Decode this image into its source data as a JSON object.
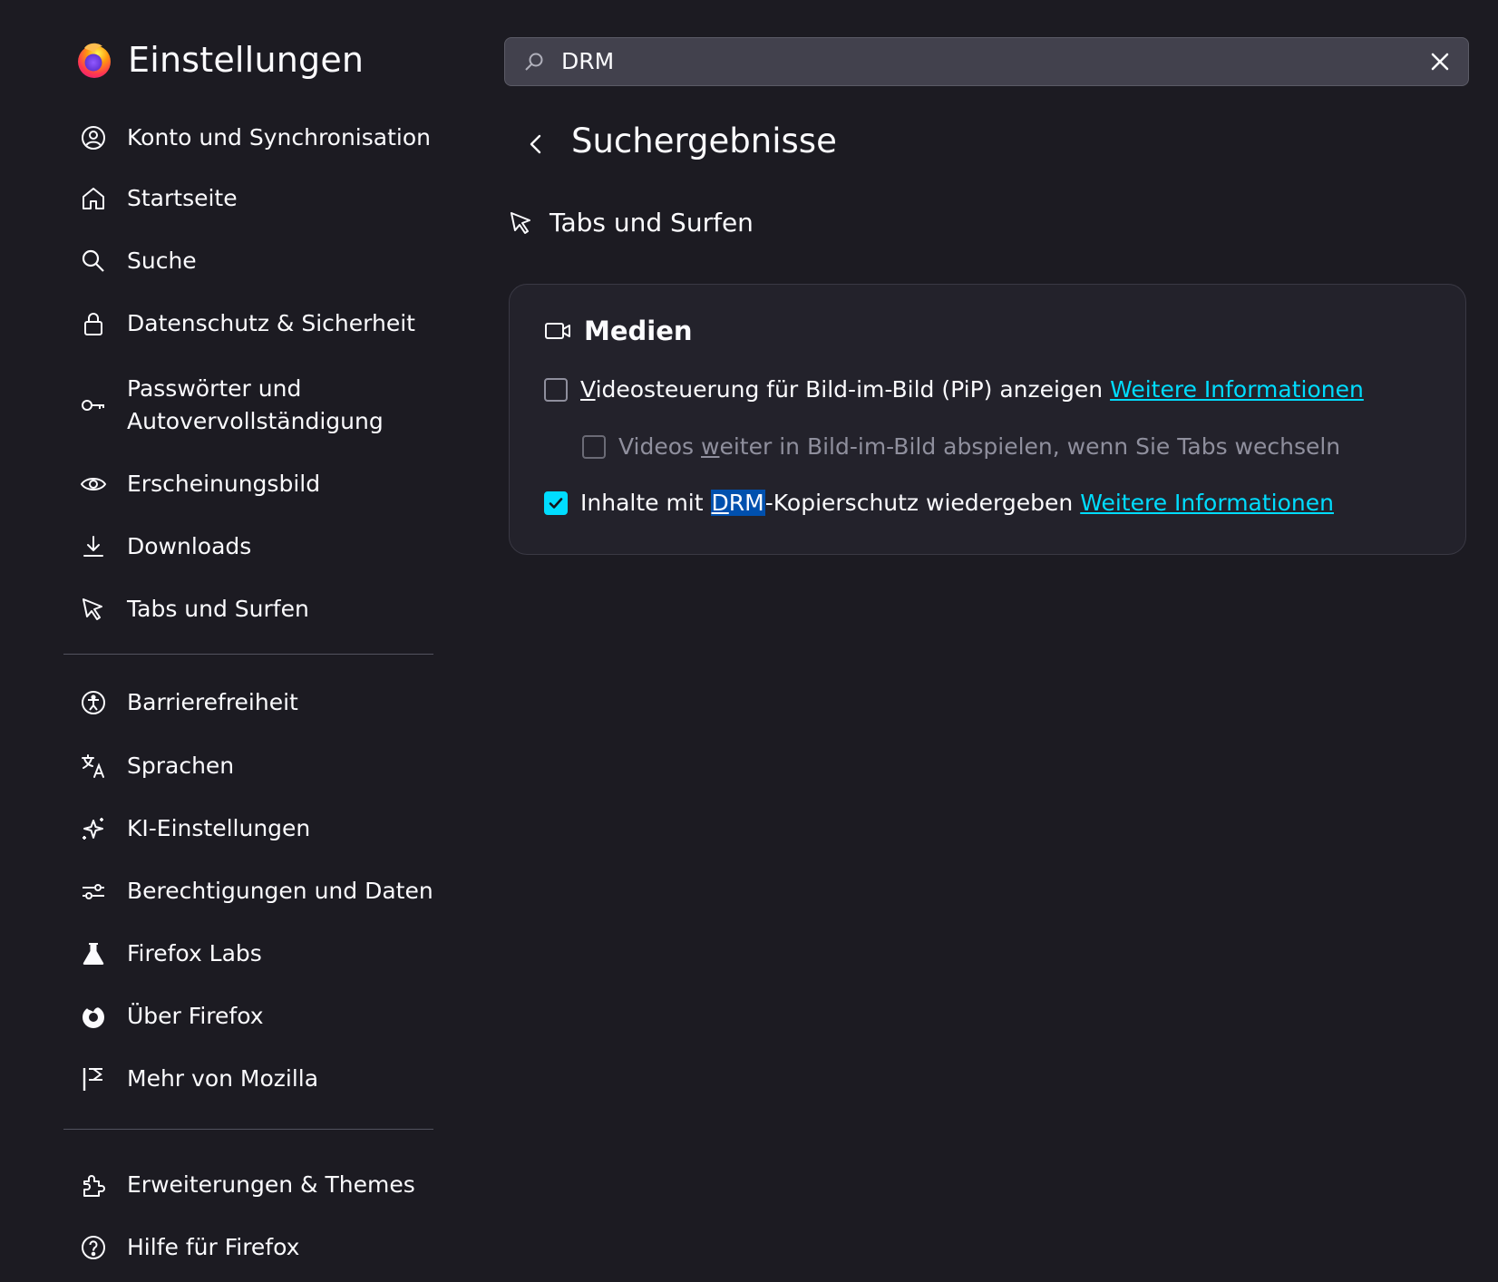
{
  "app": {
    "title": "Einstellungen",
    "logo": "firefox-logo-icon"
  },
  "sidebar": {
    "items": [
      {
        "label": "Konto und Synchronisation",
        "icon": "account-circle-icon"
      },
      {
        "label": "Startseite",
        "icon": "home-icon"
      },
      {
        "label": "Suche",
        "icon": "search-icon"
      },
      {
        "label": "Datenschutz & Sicherheit",
        "icon": "lock-icon"
      },
      {
        "label": "Passwörter und Autovervollständigung",
        "icon": "key-icon"
      },
      {
        "label": "Erscheinungsbild",
        "icon": "eye-icon"
      },
      {
        "label": "Downloads",
        "icon": "download-icon"
      },
      {
        "label": "Tabs und Surfen",
        "icon": "cursor-icon"
      }
    ],
    "items2": [
      {
        "label": "Barrierefreiheit",
        "icon": "accessibility-icon"
      },
      {
        "label": "Sprachen",
        "icon": "translate-icon"
      },
      {
        "label": "KI-Einstellungen",
        "icon": "sparkle-icon"
      },
      {
        "label": "Berechtigungen und Daten",
        "icon": "sliders-icon"
      },
      {
        "label": "Firefox Labs",
        "icon": "flask-icon"
      },
      {
        "label": "Über Firefox",
        "icon": "firefox-icon"
      },
      {
        "label": "Mehr von Mozilla",
        "icon": "mozilla-flag-icon"
      }
    ],
    "items3": [
      {
        "label": "Erweiterungen & Themes",
        "icon": "puzzle-icon"
      },
      {
        "label": "Hilfe für Firefox",
        "icon": "help-icon"
      }
    ]
  },
  "search": {
    "value": "DRM",
    "icon": "search-icon",
    "clear_icon": "close-icon"
  },
  "main": {
    "title": "Suchergebnisse",
    "section": "Tabs und Surfen",
    "group": {
      "title": "Medien",
      "options": [
        {
          "prefix": "V",
          "label_rest": "ideosteuerung für Bild-im-Bild (PiP) anzeigen",
          "link": "Weitere Informationen",
          "checked": false,
          "disabled": false
        },
        {
          "pre": "Videos ",
          "under": "w",
          "label_rest": "eiter in Bild-im-Bild abspielen, wenn Sie Tabs wechseln",
          "checked": false,
          "disabled": true
        },
        {
          "pre": "Inhalte mit ",
          "highlight_u": "D",
          "highlight_rest": "RM",
          "post": "-Kopierschutz wiedergeben",
          "link": "Weitere Informationen",
          "checked": true,
          "disabled": false
        }
      ]
    }
  },
  "colors": {
    "background": "#1c1b22",
    "accent": "#00ddff",
    "highlight": "#0050ae"
  }
}
